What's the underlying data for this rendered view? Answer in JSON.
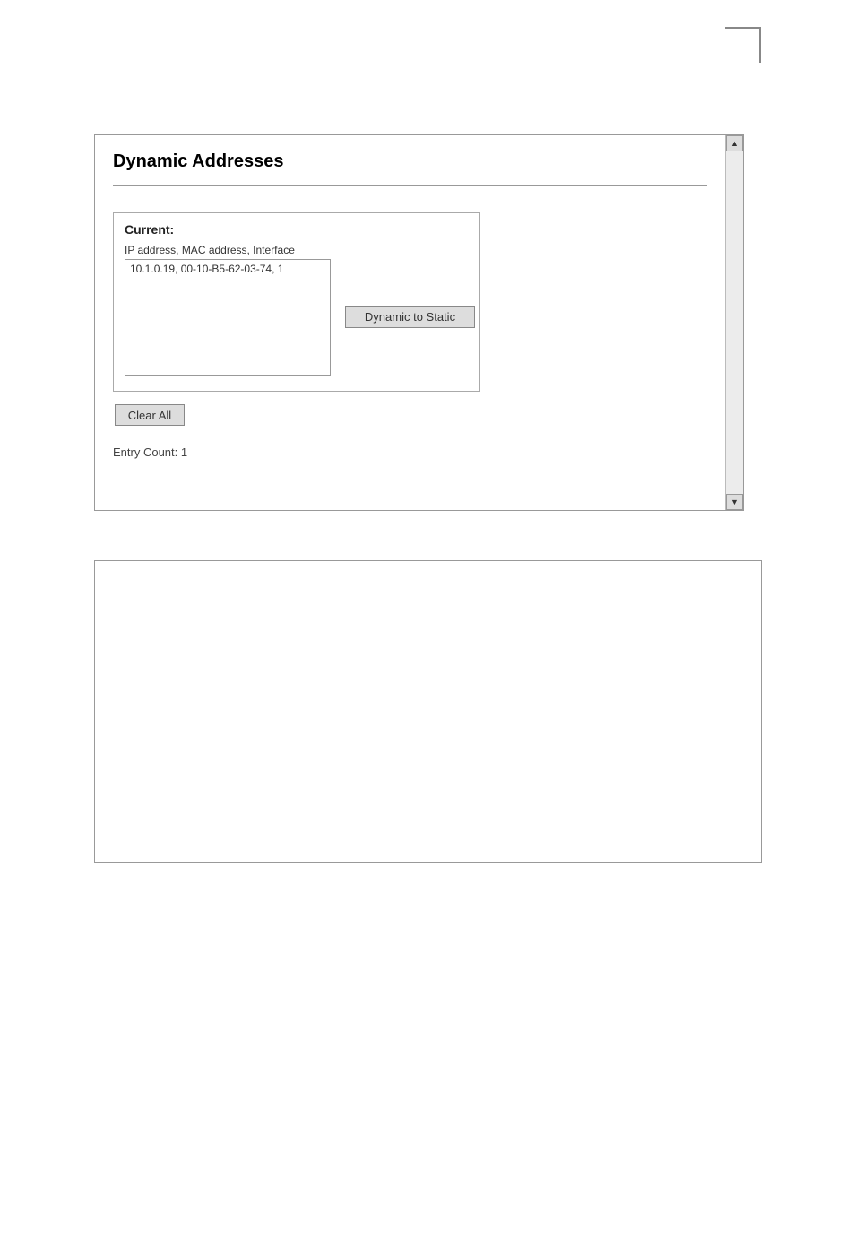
{
  "page": {
    "title": "Dynamic Addresses"
  },
  "current": {
    "label": "Current:",
    "header": "IP address, MAC address, Interface",
    "entries": [
      "10.1.0.19, 00-10-B5-62-03-74, 1"
    ]
  },
  "buttons": {
    "dynamic_to_static": "Dynamic to Static",
    "clear_all": "Clear All"
  },
  "footer": {
    "entry_count": "Entry Count: 1"
  },
  "scrollbar": {
    "up": "▲",
    "down": "▼"
  }
}
